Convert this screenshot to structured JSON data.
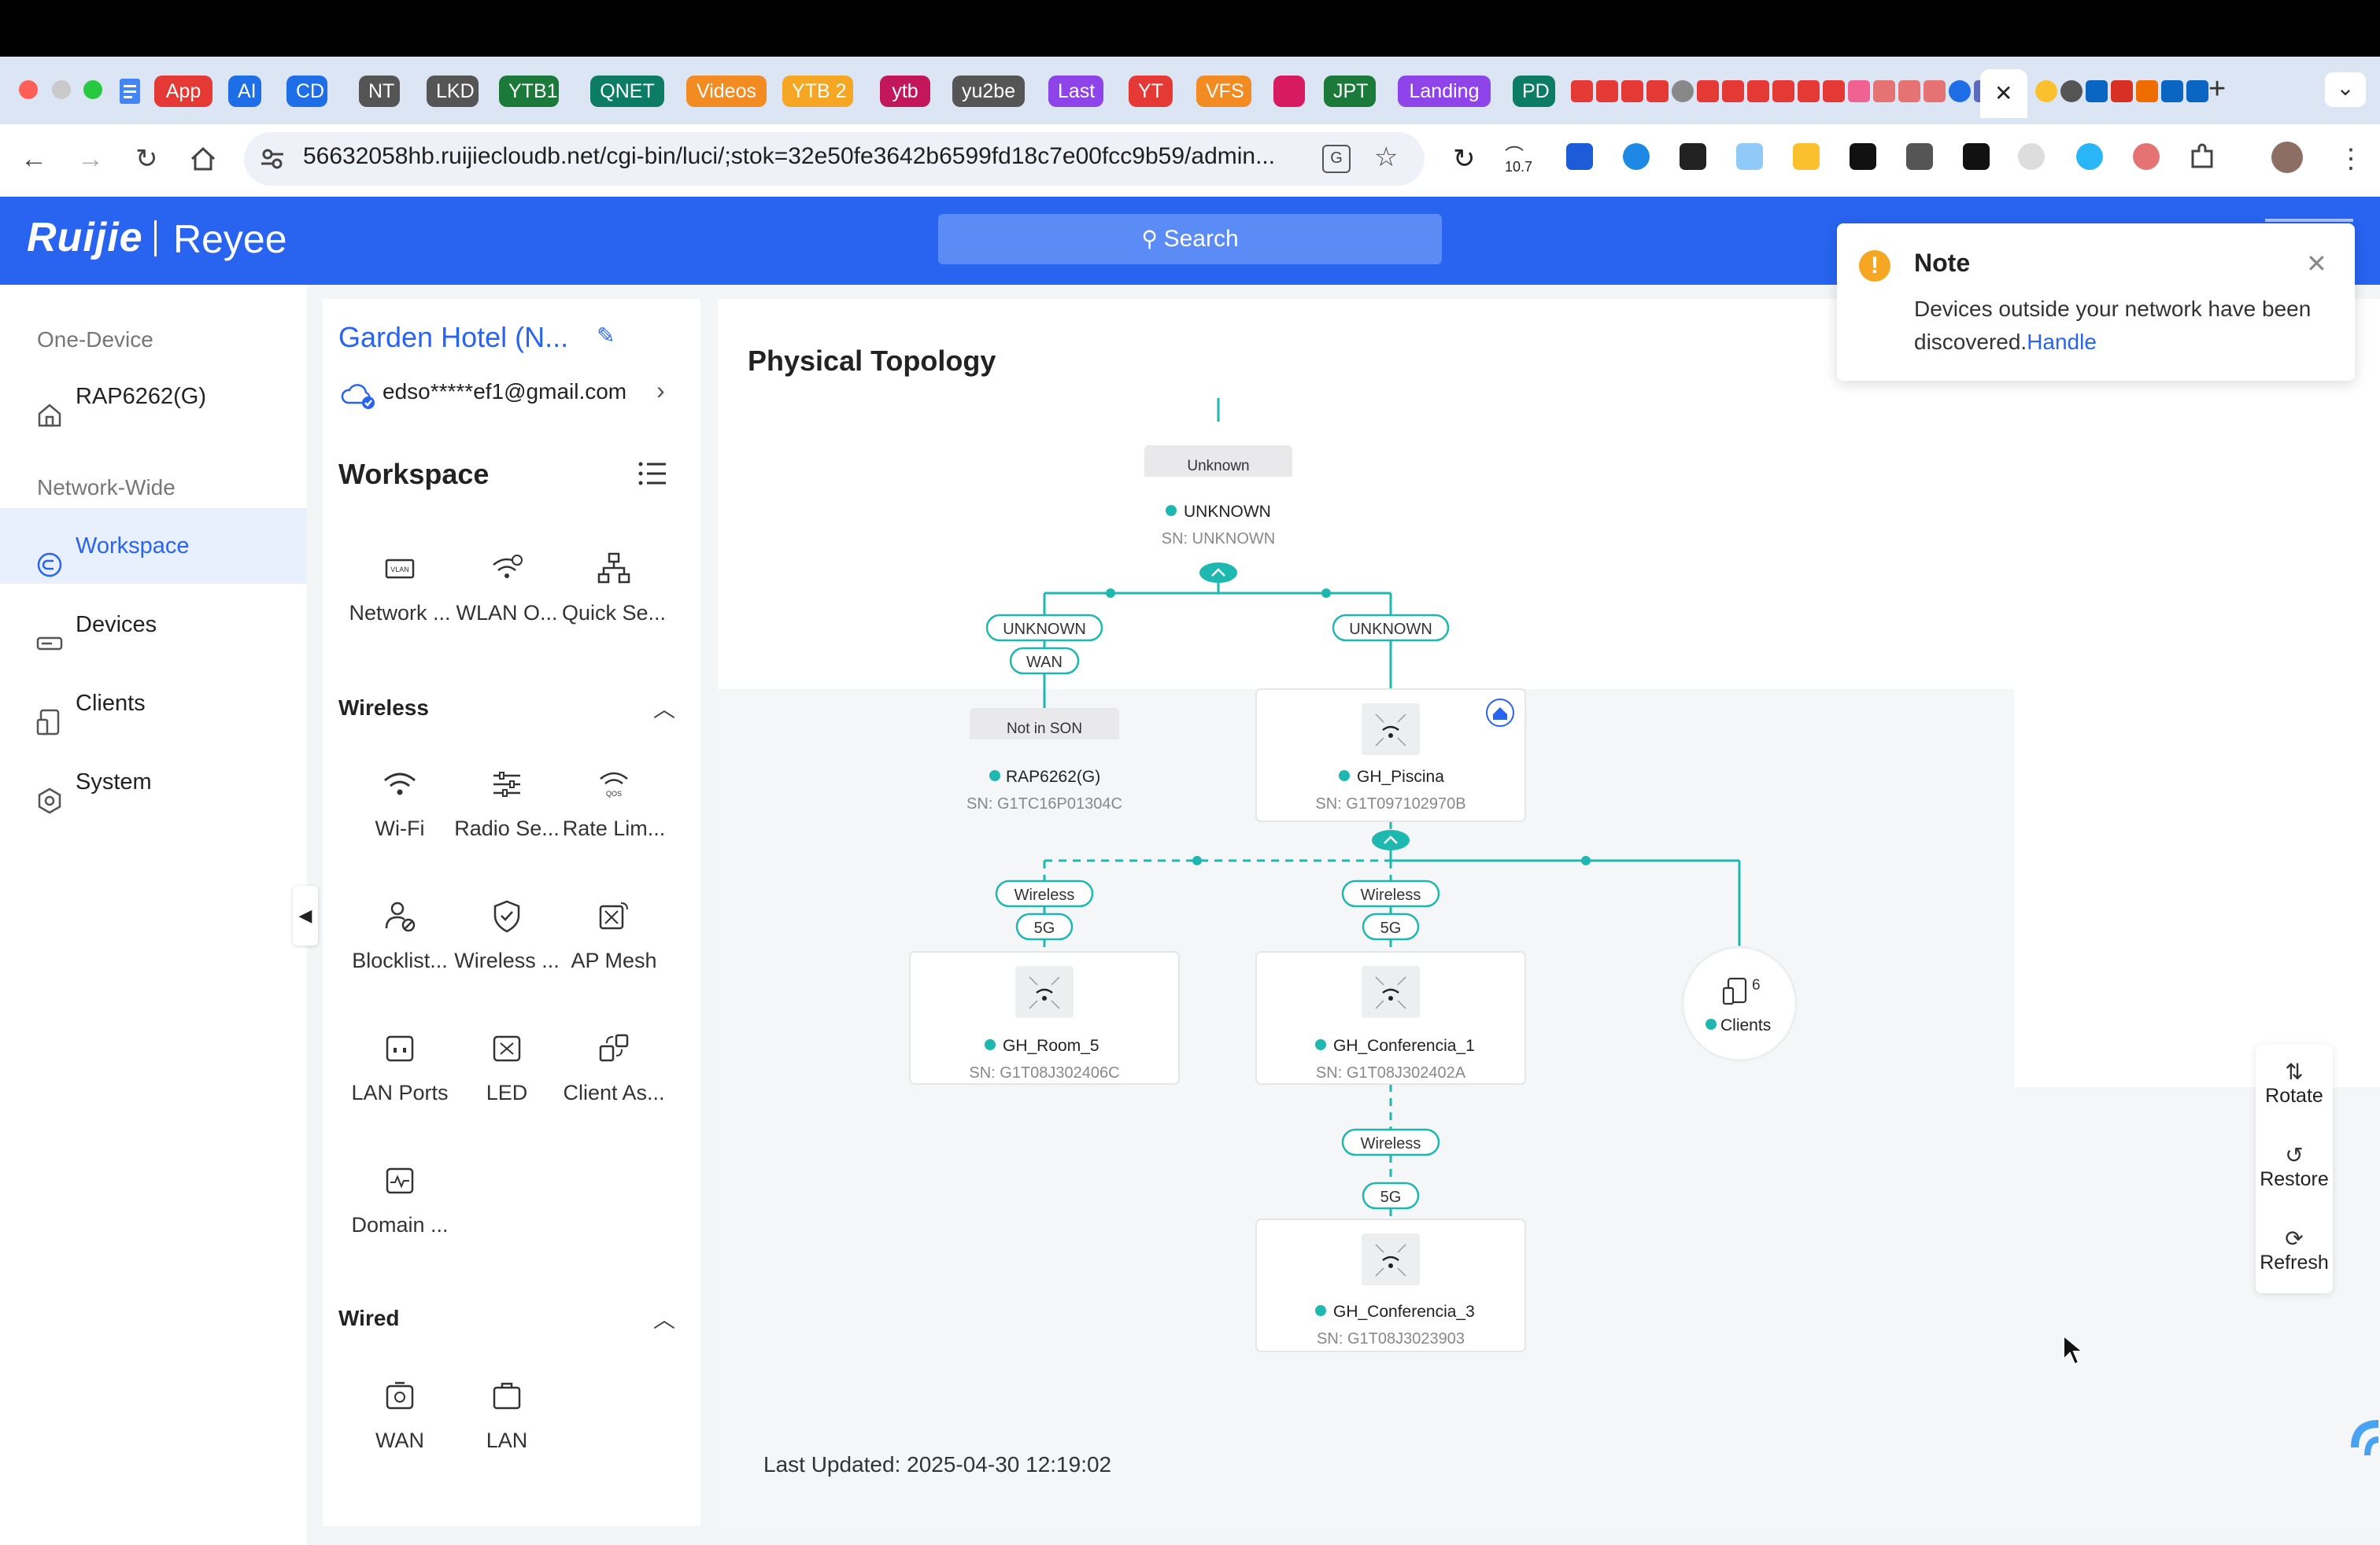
{
  "browser": {
    "tabs": [
      {
        "label": "App",
        "color": "#e53935"
      },
      {
        "label": "AI",
        "color": "#1e6ee8"
      },
      {
        "label": "CD",
        "color": "#1e6ee8"
      },
      {
        "label": "NT",
        "color": "#555555"
      },
      {
        "label": "LKD",
        "color": "#555555"
      },
      {
        "label": "YTB1",
        "color": "#1b7a3a"
      },
      {
        "label": "QNET",
        "color": "#0d7c64"
      },
      {
        "label": "Videos",
        "color": "#f28b22"
      },
      {
        "label": "YTB 2",
        "color": "#f5a623"
      },
      {
        "label": "ytb",
        "color": "#c2185b"
      },
      {
        "label": "yu2be",
        "color": "#555555"
      },
      {
        "label": "Last",
        "color": "#8e44e8"
      },
      {
        "label": "YT",
        "color": "#e53935"
      },
      {
        "label": "VFS",
        "color": "#f28b22"
      },
      {
        "label": "",
        "color": "#d81b60"
      },
      {
        "label": "JPT",
        "color": "#1b7a3a"
      },
      {
        "label": "Landing",
        "color": "#8e44e8"
      },
      {
        "label": "PD",
        "color": "#0d7c64"
      }
    ],
    "close_tab": "✕",
    "new_tab": "+",
    "tab_menu": "⌄",
    "url": "56632058hb.ruijiecloudb.net/cgi-bin/luci/;stok=32e50fe3642b6599fd18c7e00fcc9b59/admin...",
    "ext_badge": "10.7"
  },
  "app": {
    "logo_left": "Ruijie",
    "logo_right": "Reyee",
    "search_label": "Search"
  },
  "leftnav": {
    "one_device_heading": "One-Device",
    "device": "RAP6262(G)",
    "network_wide_heading": "Network-Wide",
    "items": [
      {
        "label": "Workspace"
      },
      {
        "label": "Devices"
      },
      {
        "label": "Clients"
      },
      {
        "label": "System"
      }
    ]
  },
  "mid": {
    "project": "Garden Hotel (N...",
    "account": "edso*****ef1@gmail.com",
    "workspace_title": "Workspace",
    "workspace_tiles": [
      "Network ...",
      "WLAN O...",
      "Quick Se..."
    ],
    "wireless_title": "Wireless",
    "wireless_tiles": [
      "Wi-Fi",
      "Radio Se...",
      "Rate Lim...",
      "Blocklist...",
      "Wireless ...",
      "AP Mesh",
      "LAN Ports",
      "LED",
      "Client As...",
      "Domain ..."
    ],
    "wired_title": "Wired",
    "wired_tiles": [
      "WAN",
      "LAN"
    ]
  },
  "topology": {
    "title": "Physical Topology",
    "gateway": {
      "tag": "Unknown",
      "name": "UNKNOWN",
      "sn": "SN: UNKNOWN"
    },
    "link_left": [
      "UNKNOWN",
      "WAN"
    ],
    "link_right": [
      "UNKNOWN"
    ],
    "rap": {
      "tag": "Not in SON",
      "name": "RAP6262(G)",
      "sn": "SN: G1TC16P01304C"
    },
    "piscina": {
      "name": "GH_Piscina",
      "sn": "SN: G1T097102970B"
    },
    "room5_link": [
      "Wireless",
      "5G"
    ],
    "room5": {
      "name": "GH_Room_5",
      "sn": "SN: G1T08J302406C"
    },
    "conf1_link": [
      "Wireless",
      "5G"
    ],
    "conf1": {
      "name": "GH_Conferencia_1",
      "sn": "SN: G1T08J302402A"
    },
    "clients": {
      "count": "6",
      "label": "Clients"
    },
    "conf3_link": [
      "Wireless",
      "5G"
    ],
    "conf3": {
      "name": "GH_Conferencia_3",
      "sn": "SN: G1T08J3023903"
    },
    "last_updated": "Last Updated: 2025-04-30 12:19:02",
    "accent_color": "#1fb8b0"
  },
  "toolbar": {
    "rotate": "Rotate",
    "restore": "Restore",
    "refresh": "Refresh"
  },
  "note": {
    "title": "Note",
    "body": "Devices outside your network have been discovered.",
    "link": "Handle"
  }
}
